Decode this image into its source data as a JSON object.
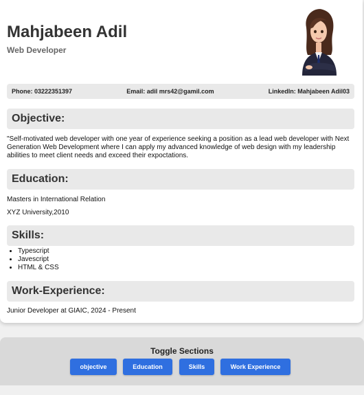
{
  "header": {
    "name": "Mahjabeen Adil",
    "title": "Web Developer",
    "avatar_icon": "woman-avatar-icon"
  },
  "contact": {
    "phone": "Phone: 03222351397",
    "email": "Email: adil mrs42@gamil.com",
    "linkedin": "LinkedIn: Mahjabeen Adil03"
  },
  "objective": {
    "heading": "Objective:",
    "text": "\"Self-motivated web developer with one year of experience seeking a position as a lead web developer with Next Generation Web Development where I can apply my advanced knowledge of web design with my leadership abilities to meet client needs and exceed their expoctations."
  },
  "education": {
    "heading": "Education:",
    "degree": "Masters in International Relation",
    "school": "XYZ University,2010"
  },
  "skills": {
    "heading": "Skills:",
    "items": [
      "Typescript",
      "Javescript",
      "HTML & CSS"
    ]
  },
  "experience": {
    "heading": "Work-Experience:",
    "text": "Junior Developer at GIAIC, 2024 - Present"
  },
  "toggle": {
    "title": "Toggle Sections",
    "buttons": [
      "objective",
      "Education",
      "Skills",
      "Work Experience"
    ],
    "button_color": "#2f6fe0"
  }
}
